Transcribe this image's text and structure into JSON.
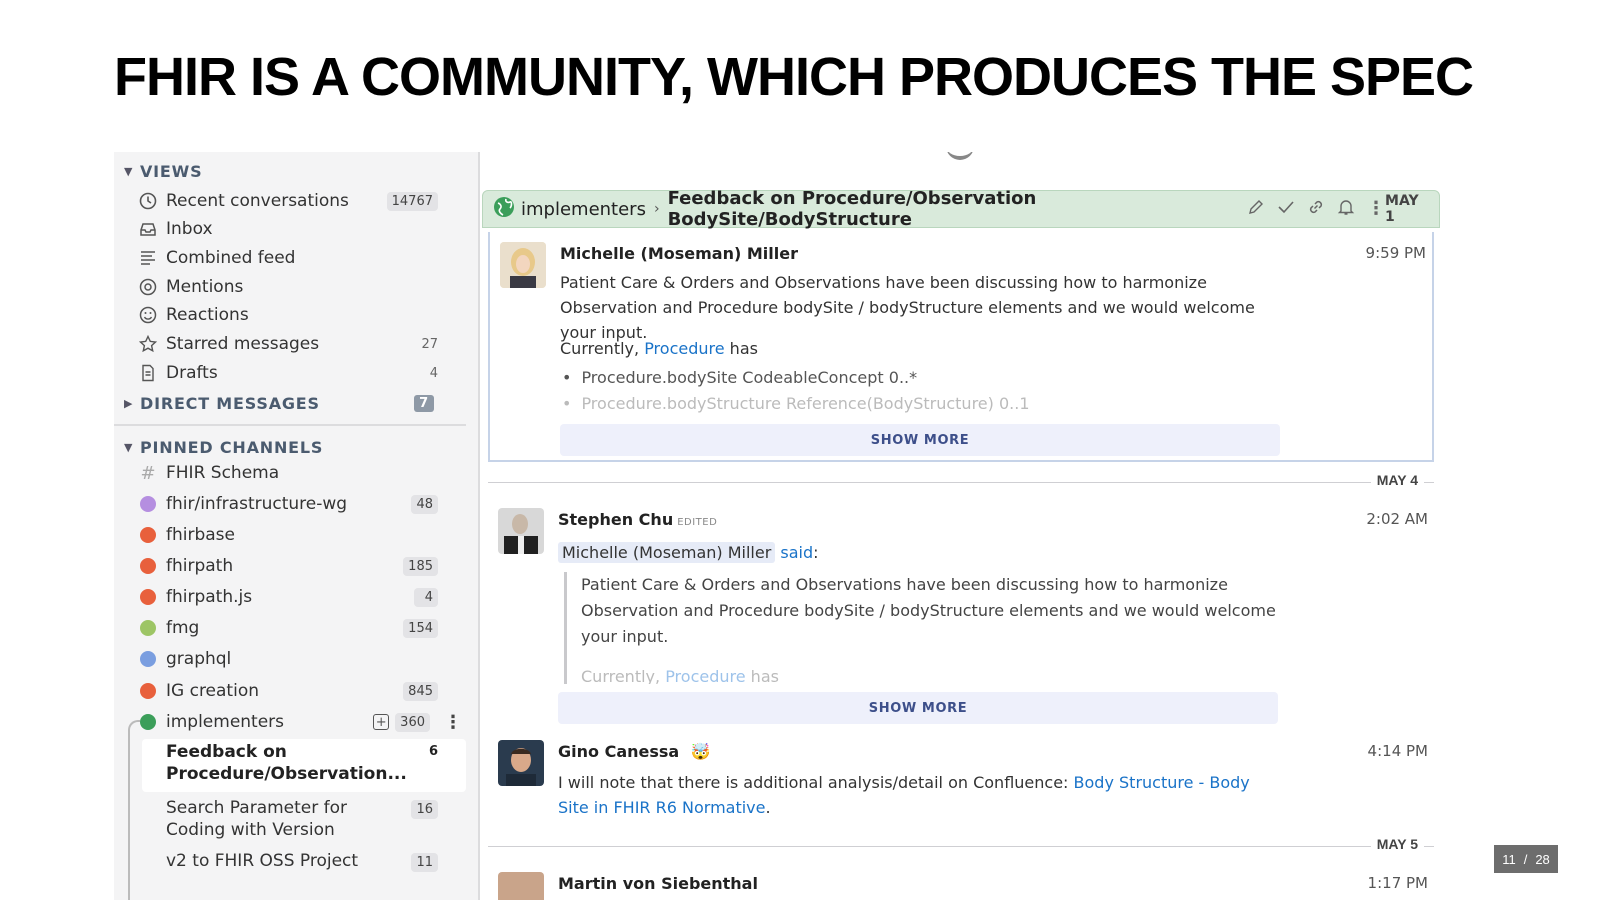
{
  "slide": {
    "title": "FHIR IS A COMMUNITY, WHICH PRODUCES THE SPEC",
    "page_current": "11",
    "page_sep": "/",
    "page_total": "28"
  },
  "sidebar": {
    "views_header": "VIEWS",
    "views": [
      {
        "label": "Recent conversations",
        "count": "14767",
        "icon": "clock-icon"
      },
      {
        "label": "Inbox",
        "count": "",
        "icon": "inbox-icon"
      },
      {
        "label": "Combined feed",
        "count": "",
        "icon": "feed-icon"
      },
      {
        "label": "Mentions",
        "count": "",
        "icon": "at-icon"
      },
      {
        "label": "Reactions",
        "count": "",
        "icon": "smile-icon"
      },
      {
        "label": "Starred messages",
        "count": "27",
        "icon": "star-icon"
      },
      {
        "label": "Drafts",
        "count": "4",
        "icon": "draft-icon"
      }
    ],
    "dm_header": "DIRECT MESSAGES",
    "dm_count": "7",
    "pinned_header": "PINNED CHANNELS",
    "channels": [
      {
        "label": "FHIR Schema",
        "count": "",
        "color": "#b0b0b0"
      },
      {
        "label": "fhir/infrastructure-wg",
        "count": "48",
        "color": "#b58ee0"
      },
      {
        "label": "fhirbase",
        "count": "",
        "color": "#e8603c"
      },
      {
        "label": "fhirpath",
        "count": "185",
        "color": "#e8603c"
      },
      {
        "label": "fhirpath.js",
        "count": "4",
        "color": "#e8603c"
      },
      {
        "label": "fmg",
        "count": "154",
        "color": "#9dc565"
      },
      {
        "label": "graphql",
        "count": "",
        "color": "#7a9ee0"
      },
      {
        "label": "IG creation",
        "count": "845",
        "color": "#e8603c"
      },
      {
        "label": "implementers",
        "count": "360",
        "color": "#3b9e5a"
      }
    ],
    "topics": [
      {
        "label": "Feedback on Procedure/Observation...",
        "count": "6"
      },
      {
        "label": "Search Parameter for Coding with Version",
        "count": "16"
      },
      {
        "label": "v2 to FHIR OSS Project",
        "count": "11"
      }
    ]
  },
  "topic_bar": {
    "stream": "implementers",
    "topic": "Feedback on Procedure/Observation BodySite/BodyStructure",
    "date": "MAY 1"
  },
  "messages": [
    {
      "sender": "Michelle (Moseman) Miller",
      "time": "9:59 PM",
      "text1": "Patient Care & Orders and Observations have been discussing how to harmonize Observation and Procedure bodySite / bodyStructure elements and we would welcome your input.",
      "currently": "Currently,",
      "procedure_link": "Procedure",
      "has": "has",
      "bullets": [
        "Procedure.bodySite CodeableConcept  0..*",
        "Procedure.bodyStructure Reference(BodyStructure) 0..1"
      ],
      "show_more": "SHOW MORE"
    },
    {
      "date_sep": "MAY 4",
      "sender": "Stephen Chu",
      "edited": "EDITED",
      "time": "2:02 AM",
      "mention": "Michelle (Moseman) Miller",
      "said": "said",
      "colon": ":",
      "quote": "Patient Care & Orders and Observations have been discussing how to harmonize Observation and Procedure bodySite / bodyStructure elements and we would welcome your input.",
      "quote_currently": "Currently,",
      "quote_link": "Procedure",
      "quote_has": "has",
      "show_more": "SHOW MORE"
    },
    {
      "sender": "Gino Canessa",
      "emoji": "🤯",
      "time": "4:14 PM",
      "text": "I will note that there is additional analysis/detail on Confluence:",
      "link": "Body Structure - Body Site in FHIR R6 Normative",
      "period": "."
    },
    {
      "date_sep": "MAY 5",
      "sender": "Martin von Siebenthal",
      "time": "1:17 PM"
    }
  ]
}
